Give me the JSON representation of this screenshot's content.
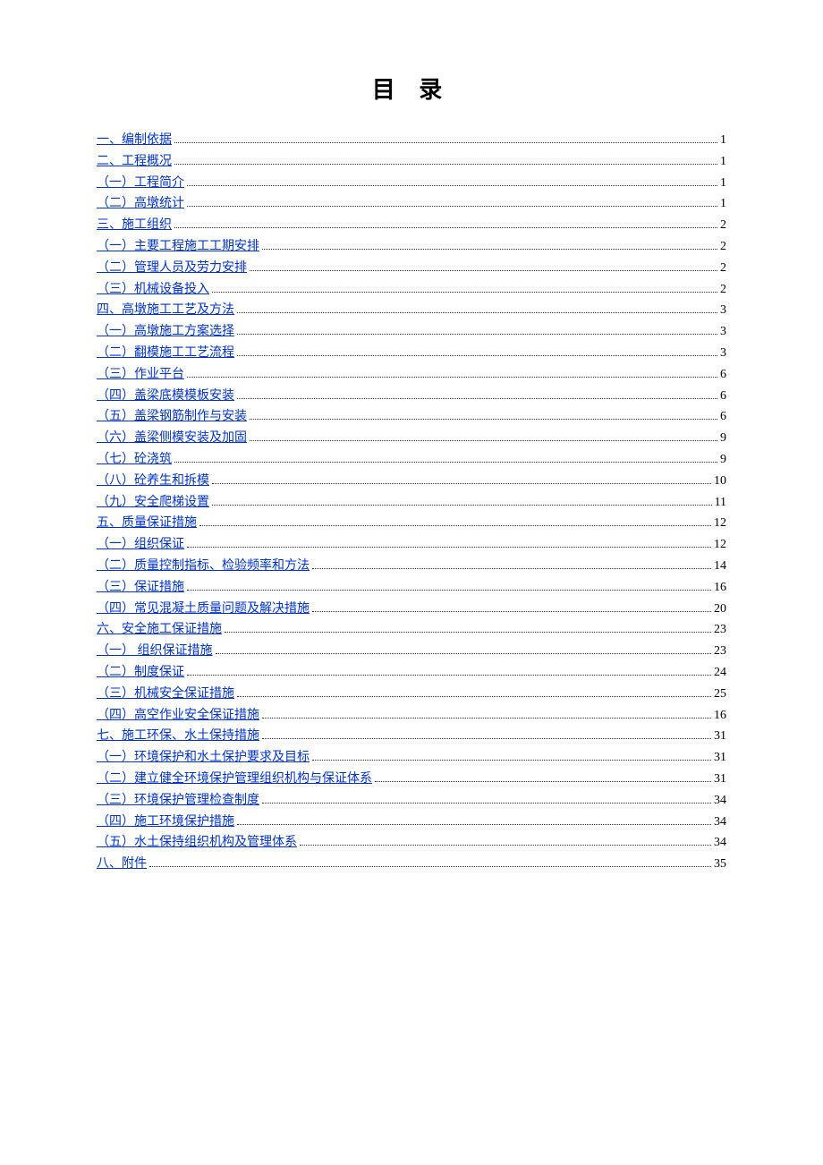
{
  "title": "目 录",
  "entries": [
    {
      "label": "一、编制依据",
      "page": "1"
    },
    {
      "label": "二、工程概况",
      "page": "1"
    },
    {
      "label": "（一）工程简介",
      "page": "1"
    },
    {
      "label": "（二）高墩统计",
      "page": "1"
    },
    {
      "label": "三、施工组织",
      "page": "2"
    },
    {
      "label": "（一）主要工程施工工期安排",
      "page": "2"
    },
    {
      "label": "（二）管理人员及劳力安排",
      "page": "2"
    },
    {
      "label": "（三）机械设备投入",
      "page": "2"
    },
    {
      "label": "四、高墩施工工艺及方法",
      "page": "3"
    },
    {
      "label": "（一）高墩施工方案选择",
      "page": "3"
    },
    {
      "label": "（二）翻模施工工艺流程",
      "page": "3"
    },
    {
      "label": "（三）作业平台",
      "page": "6"
    },
    {
      "label": "（四）盖梁底模模板安装",
      "page": "6"
    },
    {
      "label": "（五）盖梁钢筋制作与安装",
      "page": "6"
    },
    {
      "label": "（六）盖梁侧模安装及加固",
      "page": "9"
    },
    {
      "label": "（七）砼浇筑",
      "page": "9"
    },
    {
      "label": "（八）砼养生和拆模",
      "page": "10"
    },
    {
      "label": "（九）安全爬梯设置",
      "page": "11"
    },
    {
      "label": "五、质量保证措施",
      "page": "12"
    },
    {
      "label": "（一）组织保证",
      "page": "12"
    },
    {
      "label": "（二）质量控制指标、检验频率和方法",
      "page": "14"
    },
    {
      "label": "（三）保证措施",
      "page": "16"
    },
    {
      "label": "（四）常见混凝土质量问题及解决措施",
      "page": "20"
    },
    {
      "label": "六、安全施工保证措施",
      "page": "23"
    },
    {
      "label": "（一） 组织保证措施",
      "page": "23"
    },
    {
      "label": "（二）制度保证",
      "page": "24"
    },
    {
      "label": "（三）机械安全保证措施",
      "page": "25"
    },
    {
      "label": "（四）高空作业安全保证措施",
      "page": "16"
    },
    {
      "label": "七、施工环保、水土保持措施",
      "page": "31"
    },
    {
      "label": "（一）环境保护和水土保护要求及目标",
      "page": "31"
    },
    {
      "label": "（二）建立健全环境保护管理组织机构与保证体系",
      "page": "31"
    },
    {
      "label": "（三）环境保护管理检查制度",
      "page": "34"
    },
    {
      "label": "（四）施工环境保护措施",
      "page": "34"
    },
    {
      "label": "（五）水土保持组织机构及管理体系",
      "page": "34"
    },
    {
      "label": "八、附件",
      "page": "35"
    }
  ]
}
